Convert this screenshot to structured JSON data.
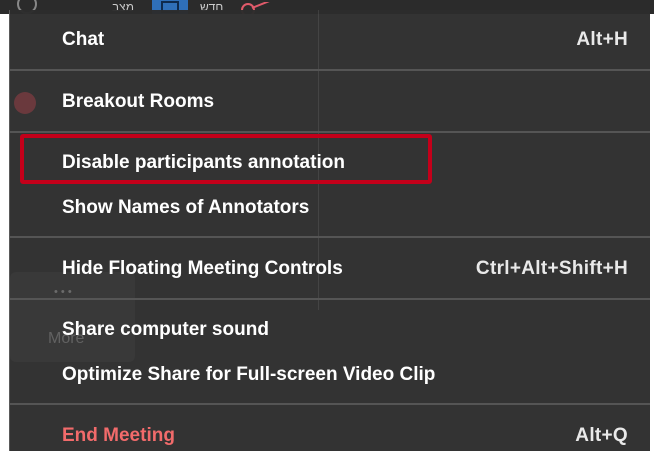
{
  "window": {
    "title": ""
  },
  "toolbar": {
    "new_label": "חדש",
    "share_label": "מצב",
    "icons": [
      "pen-annotate-icon",
      "share-screen-icon",
      "scissors-icon"
    ]
  },
  "menu": {
    "items": [
      {
        "id": "chat",
        "label": "Chat",
        "shortcut": "Alt+H"
      },
      {
        "id": "breakout-rooms",
        "label": "Breakout Rooms",
        "shortcut": ""
      },
      {
        "id": "disable-annotation",
        "label": "Disable participants annotation",
        "shortcut": ""
      },
      {
        "id": "show-annotators",
        "label": "Show Names of Annotators",
        "shortcut": ""
      },
      {
        "id": "hide-floating-controls",
        "label": "Hide Floating Meeting Controls",
        "shortcut": "Ctrl+Alt+Shift+H"
      },
      {
        "id": "share-sound",
        "label": "Share computer sound",
        "shortcut": ""
      },
      {
        "id": "optimize-share",
        "label": "Optimize Share for Full-screen Video Clip",
        "shortcut": ""
      },
      {
        "id": "end-meeting",
        "label": "End Meeting",
        "shortcut": "Alt+Q"
      }
    ]
  },
  "background": {
    "more_label": "More",
    "dots": "• • •"
  },
  "colors": {
    "menu_bg": "#2c2c2c",
    "text": "#ffffff",
    "danger": "#f26b6b",
    "highlight": "#c4001a",
    "separator": "#555555"
  }
}
